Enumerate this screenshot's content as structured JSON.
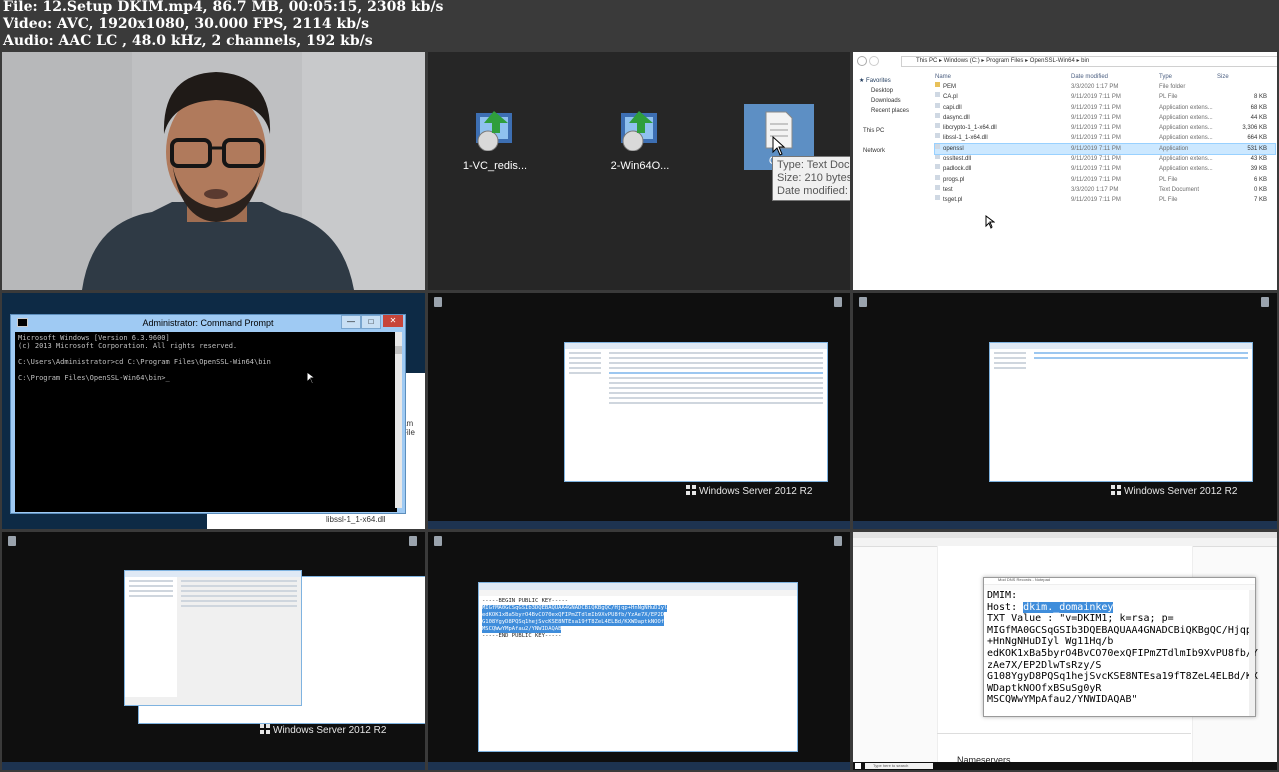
{
  "header": {
    "line1": "File: 12.Setup DKIM.mp4, 86.7 MB, 00:05:15, 2308 kb/s",
    "line2": "Video: AVC, 1920x1080, 30.000 FPS, 2114 kb/s",
    "line3": "Audio: AAC LC , 48.0 kHz, 2 channels, 192 kb/s"
  },
  "desktop": {
    "icons": [
      "1-VC_redis...",
      "2-Win64O...",
      "Con"
    ],
    "tooltip": [
      "Type: Text Doc",
      "Size: 210 bytes",
      "Date modified:"
    ]
  },
  "explorer": {
    "breadcrumb": [
      "This PC",
      "Windows (C:)",
      "Program Files",
      "OpenSSL-Win64",
      "bin"
    ],
    "nav": {
      "favorites": "Favorites",
      "items": [
        "Desktop",
        "Downloads",
        "Recent places"
      ],
      "thispc": "This PC",
      "network": "Network"
    },
    "columns": [
      "Name",
      "Date modified",
      "Type",
      "Size"
    ],
    "rows": [
      {
        "name": "PEM",
        "date": "3/3/2020 1:17 PM",
        "type": "File folder",
        "size": ""
      },
      {
        "name": "CA.pl",
        "date": "9/11/2019 7:11 PM",
        "type": "PL File",
        "size": "8 KB"
      },
      {
        "name": "capi.dll",
        "date": "9/11/2019 7:11 PM",
        "type": "Application extens...",
        "size": "68 KB"
      },
      {
        "name": "dasync.dll",
        "date": "9/11/2019 7:11 PM",
        "type": "Application extens...",
        "size": "44 KB"
      },
      {
        "name": "libcrypto-1_1-x64.dll",
        "date": "9/11/2019 7:11 PM",
        "type": "Application extens...",
        "size": "3,306 KB"
      },
      {
        "name": "libssl-1_1-x64.dll",
        "date": "9/11/2019 7:11 PM",
        "type": "Application extens...",
        "size": "664 KB"
      },
      {
        "name": "openssl",
        "date": "9/11/2019 7:11 PM",
        "type": "Application",
        "size": "531 KB"
      },
      {
        "name": "ossltest.dll",
        "date": "9/11/2019 7:11 PM",
        "type": "Application extens...",
        "size": "43 KB"
      },
      {
        "name": "padlock.dll",
        "date": "9/11/2019 7:11 PM",
        "type": "Application extens...",
        "size": "39 KB"
      },
      {
        "name": "progs.pl",
        "date": "9/11/2019 7:11 PM",
        "type": "PL File",
        "size": "6 KB"
      },
      {
        "name": "test",
        "date": "3/3/2020 1:17 PM",
        "type": "Text Document",
        "size": "0 KB"
      },
      {
        "name": "tsget.pl",
        "date": "9/11/2019 7:11 PM",
        "type": "PL File",
        "size": "7 KB"
      }
    ]
  },
  "cmd": {
    "title": "Administrator: Command Prompt",
    "lines": [
      "Microsoft Windows [Version 6.3.9600]",
      "(c) 2013 Microsoft Corporation. All rights reserved.",
      "",
      "C:\\Users\\Administrator>cd C:\\Program Files\\OpenSSL-Win64\\bin",
      "",
      "C:\\Program Files\\OpenSSL-Win64\\bin>_"
    ],
    "behind_text": "am File",
    "behind_file": "libssl-1_1-x64.dll"
  },
  "server": {
    "logo": "Windows Server 2012 R2"
  },
  "notepad": {
    "begin": "-----BEGIN PUBLIC KEY-----",
    "key": [
      "MIGfMA0GCSqGSIb3DQEBAQUAA4GNADCBiQKBgQC/Hjqp+HnNgNHuDIyl",
      "edKOK1xBa5byrO4BvCO70exQFIPmZTdlmIb9XvPU8fb/YzAe7X/EP2D",
      "G108YgyD8PQSq1hejSvcKSE8NTEsa19fT8ZeL4ELBd/KXWDaptkNOOf",
      "MSCQWwYMpAfau2/YNWIDAQAB"
    ],
    "end": "-----END PUBLIC KEY-----"
  },
  "dns": {
    "notepad_title": "Mod DNS Records - Notepad",
    "dmim": "DMIM:",
    "host_label": "Host: ",
    "host_value": "dkim._domainkey",
    "txt": [
      "TXT Value : \"v=DKIM1; k=rsa; p=",
      "MIGfMA0GCSqGSIb3DQEBAQUAA4GNADCBiQKBgQC/Hjqp",
      "+HnNgNHuDIyl Wg11Hq/b",
      "edKOK1xBa5byrO4BvCO70exQFIPmZTdlmIb9XvPU8fb/Y",
      "zAe7X/EP2DlwTsRzy/S",
      "G108YgyD8PQSq1hejSvcKSE8NTEsa19fT8ZeL4ELBd/KX",
      "WDaptkNOOfxBSuSg0yR",
      "MSCQWwYMpAfau2/YNWIDAQAB\""
    ],
    "nameservers": "Nameservers",
    "search_placeholder": "Type here to search"
  }
}
